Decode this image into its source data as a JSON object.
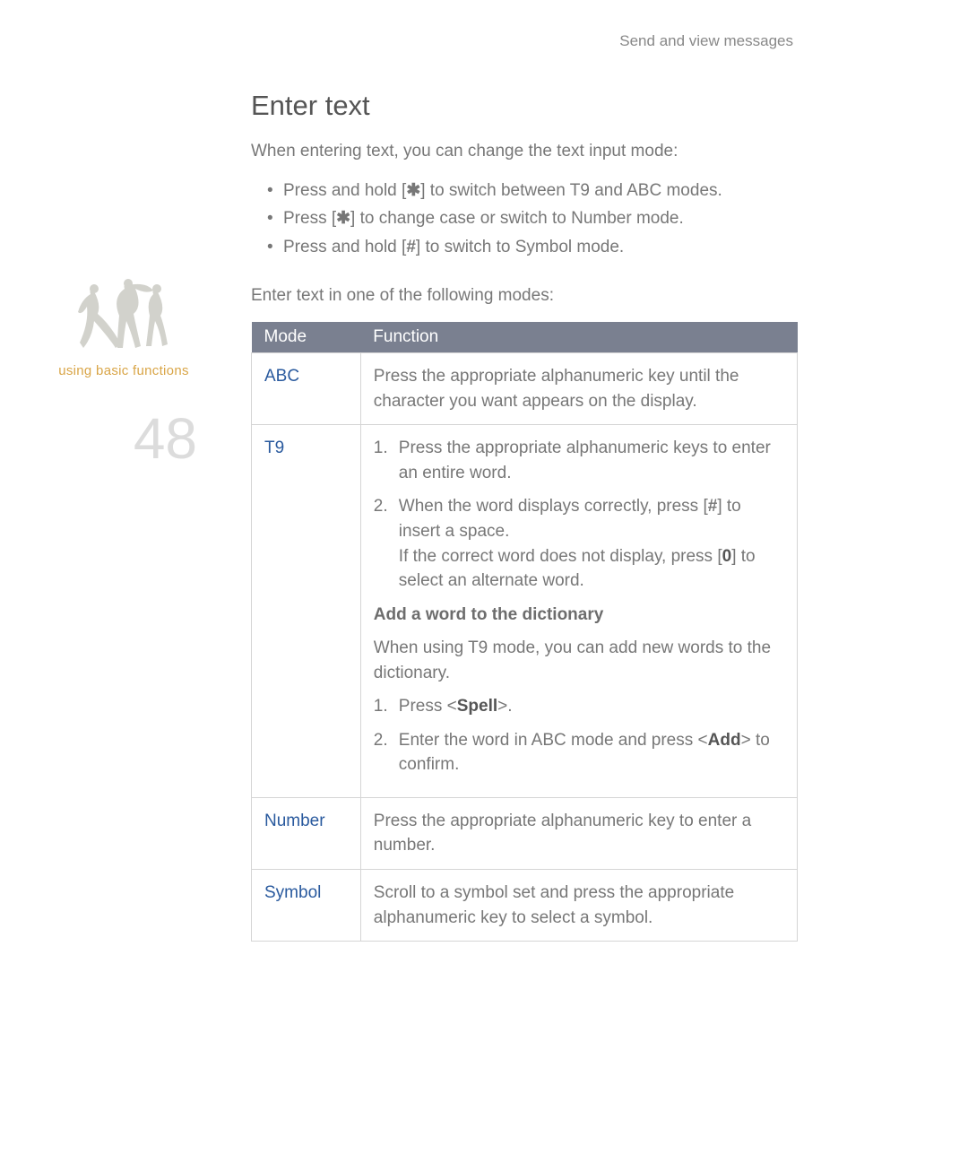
{
  "running_header": "Send and view messages",
  "sidebar": {
    "caption": "using basic functions",
    "page_number": "48"
  },
  "heading": "Enter text",
  "intro": "When entering text, you can change the text input mode:",
  "bullets": {
    "b1_pre": "Press and hold [",
    "b1_post": "] to switch between T9 and ABC modes.",
    "b2_pre": "Press [",
    "b2_post": "] to change case or switch to Number mode.",
    "b3_pre": "Press and hold [",
    "b3_post": "] to switch to Symbol mode."
  },
  "subintro": "Enter text in one of the following modes:",
  "table_header": {
    "mode": "Mode",
    "function": "Function"
  },
  "modes": {
    "abc": {
      "name": "ABC",
      "text": "Press the appropriate alphanumeric key until the character you want appears on the display."
    },
    "t9": {
      "name": "T9",
      "step1": "Press the appropriate alphanumeric keys to enter an entire word.",
      "step2_pre": "When the word displays correctly, press [",
      "step2_post": "] to insert a space.",
      "step2_note_pre": "If the correct word does not display, press [",
      "step2_key": "0",
      "step2_note_post": "] to select an alternate word.",
      "subhead": "Add a word to the dictionary",
      "subtext": "When using T9 mode, you can add new words to the dictionary.",
      "sstep1_pre": "Press <",
      "sstep1_key": "Spell",
      "sstep1_post": ">.",
      "sstep2_pre": "Enter the word in ABC mode and press <",
      "sstep2_key": "Add",
      "sstep2_post": "> to confirm."
    },
    "number": {
      "name": "Number",
      "text": "Press the appropriate alphanumeric key to enter a number."
    },
    "symbol": {
      "name": "Symbol",
      "text": "Scroll to a symbol set and press the appropriate alphanumeric key to select a symbol."
    }
  },
  "glyphs": {
    "star": "✱",
    "hash": "#"
  }
}
